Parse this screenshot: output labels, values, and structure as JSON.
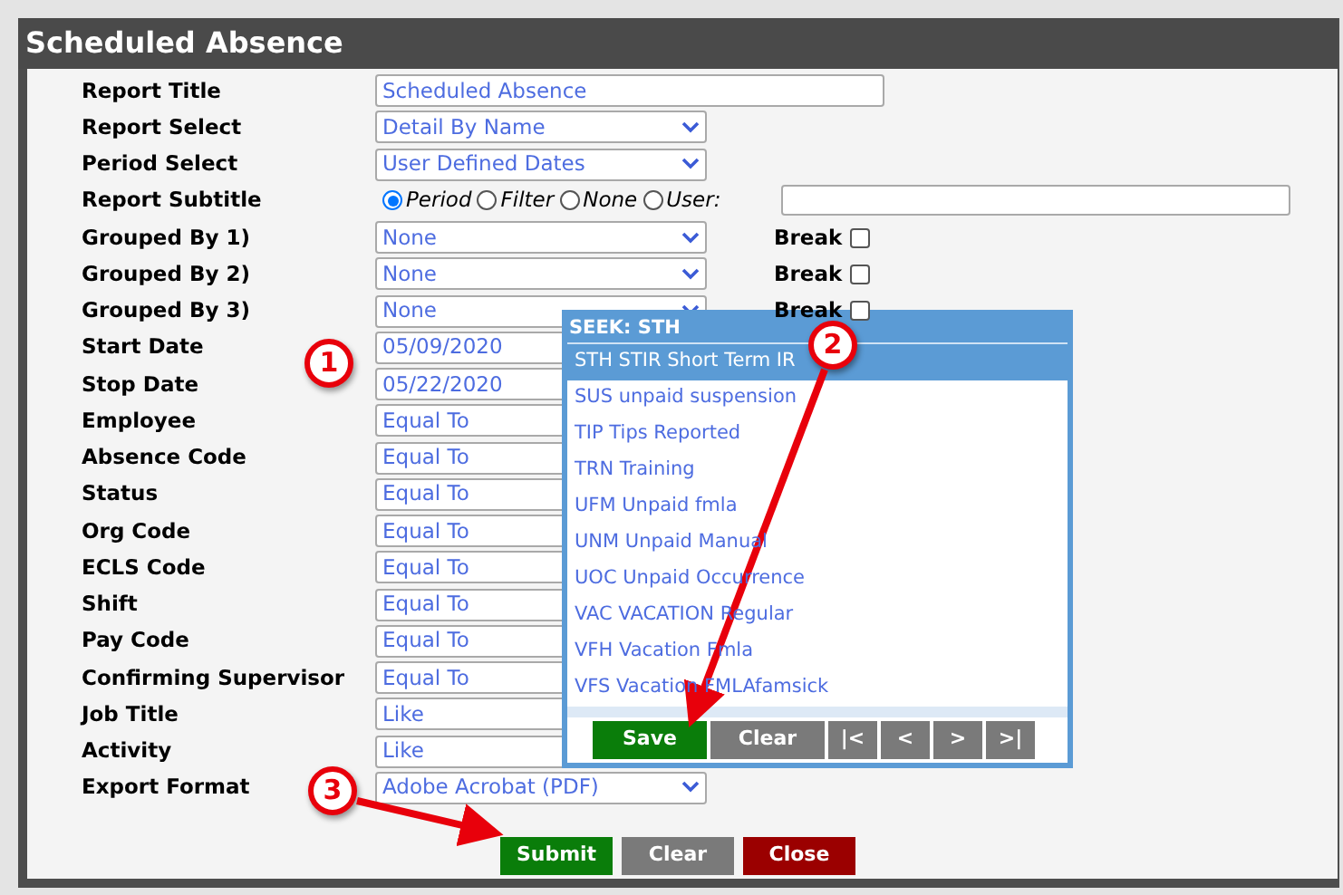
{
  "window": {
    "title": "Scheduled Absence"
  },
  "fields": [
    {
      "label": "Report Title",
      "kind": "text",
      "value": "Scheduled Absence"
    },
    {
      "label": "Report Select",
      "kind": "select",
      "value": "Detail By Name"
    },
    {
      "label": "Period Select",
      "kind": "select",
      "value": "User Defined Dates"
    },
    {
      "label": "Report Subtitle",
      "kind": "radio",
      "options": [
        {
          "label": "Period",
          "selected": true
        },
        {
          "label": "Filter",
          "selected": false
        },
        {
          "label": "None",
          "selected": false
        },
        {
          "label": "User:",
          "selected": false
        }
      ]
    },
    {
      "label": "Grouped By 1)",
      "kind": "select",
      "value": "None",
      "break": {
        "label": "Break",
        "checked": false
      }
    },
    {
      "label": "Grouped By 2)",
      "kind": "select",
      "value": "None",
      "break": {
        "label": "Break",
        "checked": false
      }
    },
    {
      "label": "Grouped By 3)",
      "kind": "select",
      "value": "None",
      "break": {
        "label": "Break",
        "checked": false
      }
    },
    {
      "label": "Start Date",
      "kind": "text",
      "value": "05/09/2020"
    },
    {
      "label": "Stop Date",
      "kind": "text",
      "value": "05/22/2020"
    },
    {
      "label": "Employee",
      "kind": "select",
      "value": "Equal To"
    },
    {
      "label": "Absence Code",
      "kind": "select",
      "value": "Equal To"
    },
    {
      "label": "Status",
      "kind": "select",
      "value": "Equal To"
    },
    {
      "label": "Org Code",
      "kind": "select",
      "value": "Equal To"
    },
    {
      "label": "ECLS Code",
      "kind": "select",
      "value": "Equal To"
    },
    {
      "label": "Shift",
      "kind": "select",
      "value": "Equal To"
    },
    {
      "label": "Pay Code",
      "kind": "select",
      "value": "Equal To"
    },
    {
      "label": "Confirming Supervisor",
      "kind": "select",
      "value": "Equal To"
    },
    {
      "label": "Job Title",
      "kind": "select",
      "value": "Like"
    },
    {
      "label": "Activity",
      "kind": "select",
      "value": "Like"
    },
    {
      "label": "Export Format",
      "kind": "select",
      "value": "Adobe Acrobat (PDF)"
    }
  ],
  "buttons": [
    {
      "label": "Submit",
      "kind": "submit"
    },
    {
      "label": "Clear",
      "kind": "clear"
    },
    {
      "label": "Close",
      "kind": "close"
    }
  ],
  "popup": {
    "title": "SEEK: STH",
    "items": [
      {
        "label": "STH STIR Short Term IR",
        "selected": true
      },
      {
        "label": "SUS unpaid suspension",
        "selected": false
      },
      {
        "label": "TIP Tips Reported",
        "selected": false
      },
      {
        "label": "TRN Training",
        "selected": false
      },
      {
        "label": "UFM Unpaid fmla",
        "selected": false
      },
      {
        "label": "UNM Unpaid Manual",
        "selected": false
      },
      {
        "label": "UOC Unpaid Occurrence",
        "selected": false
      },
      {
        "label": "VAC VACATION Regular",
        "selected": false
      },
      {
        "label": "VFH Vacation Fmla",
        "selected": false
      },
      {
        "label": "VFS Vacation FMLAfamsick",
        "selected": false
      }
    ],
    "buttons": [
      {
        "label": "Save",
        "kind": "save"
      },
      {
        "label": "Clear",
        "kind": "clear"
      },
      {
        "label": "|<",
        "kind": "nav"
      },
      {
        "label": "<",
        "kind": "nav"
      },
      {
        "label": ">",
        "kind": "nav"
      },
      {
        "label": ">|",
        "kind": "nav"
      }
    ]
  },
  "annotations": [
    {
      "label": "1"
    },
    {
      "label": "2"
    },
    {
      "label": "3"
    }
  ]
}
